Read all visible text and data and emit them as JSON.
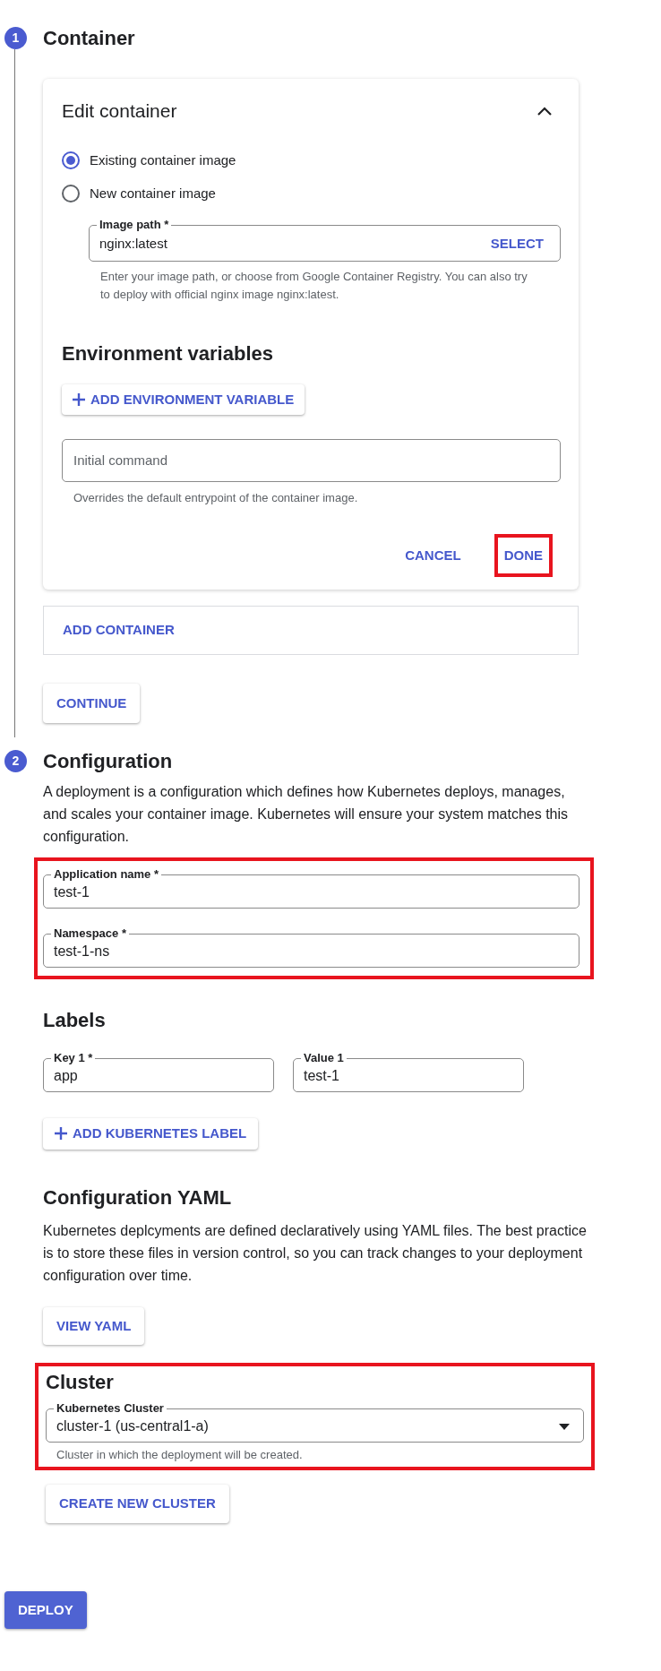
{
  "step_1": {
    "number": "1",
    "title": "Container"
  },
  "edit_container": {
    "title": "Edit container",
    "expanded": true,
    "radios": [
      {
        "label": "Existing container image",
        "selected": true
      },
      {
        "label": "New container image",
        "selected": false
      }
    ],
    "image_path": {
      "label": "Image path *",
      "value": "nginx:latest",
      "action": "SELECT",
      "helper": "Enter your image path, or choose from Google Container Registry. You can also try to deploy with official nginx image nginx:latest."
    },
    "env_heading": "Environment variables",
    "add_env_button": "ADD ENVIRONMENT VARIABLE",
    "initial_command": {
      "placeholder": "Initial command",
      "helper": "Overrides the default entrypoint of the container image."
    },
    "actions": [
      {
        "label": "CANCEL",
        "highlighted": false
      },
      {
        "label": "DONE",
        "highlighted": true
      }
    ]
  },
  "add_container": "ADD CONTAINER",
  "continue_button": "CONTINUE",
  "step_2": {
    "number": "2",
    "title": "Configuration",
    "description": "A deployment is a configuration which defines how Kubernetes deploys, manages, and scales your container image. Kubernetes will ensure your system matches this configuration."
  },
  "config_fields": {
    "highlighted": true,
    "fields": [
      {
        "label": "Application name *",
        "value": "test-1"
      },
      {
        "label": "Namespace *",
        "value": "test-1-ns"
      }
    ]
  },
  "labels": {
    "heading": "Labels",
    "fields": [
      {
        "label": "Key 1 *",
        "value": "app"
      },
      {
        "label": "Value 1",
        "value": "test-1"
      }
    ],
    "add_button": "ADD KUBERNETES LABEL"
  },
  "yaml": {
    "heading": "Configuration YAML",
    "description": "Kubernetes deplcyments are defined declaratively using YAML files. The best practice is to store these files in version control, so you can track changes to your deployment configuration over time.",
    "button": "VIEW YAML"
  },
  "cluster": {
    "highlighted": true,
    "heading": "Cluster",
    "select": {
      "label": "Kubernetes Cluster",
      "value": "cluster-1 (us-central1-a)",
      "helper": "Cluster in which the deployment will be created."
    },
    "create_button": "CREATE NEW CLUSTER"
  },
  "deploy_button": "DEPLOY"
}
